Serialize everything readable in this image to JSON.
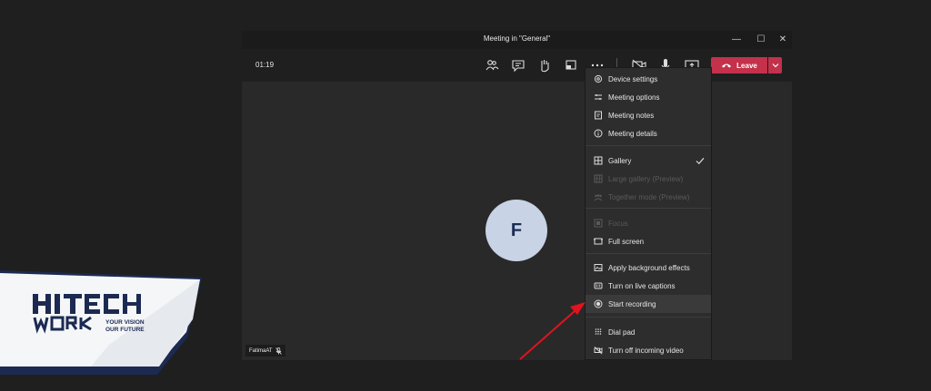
{
  "window": {
    "title": "Meeting in \"General\""
  },
  "window_controls": {
    "minimize": "—",
    "maximize": "☐",
    "close": "✕"
  },
  "toolbar": {
    "timer": "01:19",
    "leave_label": "Leave",
    "icons": [
      "people-icon",
      "chat-icon",
      "raise-hand-icon",
      "share-tray-icon",
      "more-icon",
      "camera-off-icon",
      "mic-icon",
      "share-screen-icon"
    ]
  },
  "participant": {
    "initial": "F",
    "name": "FatimaAT"
  },
  "menu": {
    "items": [
      {
        "label": "Device settings",
        "icon": "gear-icon",
        "disabled": false
      },
      {
        "label": "Meeting options",
        "icon": "options-icon",
        "disabled": false
      },
      {
        "label": "Meeting notes",
        "icon": "notes-icon",
        "disabled": false
      },
      {
        "label": "Meeting details",
        "icon": "info-icon",
        "disabled": false
      },
      {
        "label": "Gallery",
        "icon": "gallery-icon",
        "disabled": false,
        "checked": true
      },
      {
        "label": "Large gallery (Preview)",
        "icon": "large-gallery-icon",
        "disabled": true
      },
      {
        "label": "Together mode (Preview)",
        "icon": "together-mode-icon",
        "disabled": true
      },
      {
        "label": "Focus",
        "icon": "focus-icon",
        "disabled": true
      },
      {
        "label": "Full screen",
        "icon": "full-screen-icon",
        "disabled": false
      },
      {
        "label": "Apply background effects",
        "icon": "background-effects-icon",
        "disabled": false
      },
      {
        "label": "Turn on live captions",
        "icon": "captions-icon",
        "disabled": false
      },
      {
        "label": "Start recording",
        "icon": "record-icon",
        "disabled": false,
        "highlighted": true
      },
      {
        "label": "Dial pad",
        "icon": "dial-pad-icon",
        "disabled": false
      },
      {
        "label": "Turn off incoming video",
        "icon": "video-off-icon",
        "disabled": false
      }
    ]
  },
  "watermark": {
    "brand": "HITECH WORK",
    "tagline_1": "YOUR VISION",
    "tagline_2": "OUR FUTURE"
  },
  "colors": {
    "leave_red": "#c4314b",
    "arrow_red": "#e0141e",
    "avatar_bg": "#c8d3e5",
    "avatar_text": "#1b2c53"
  }
}
